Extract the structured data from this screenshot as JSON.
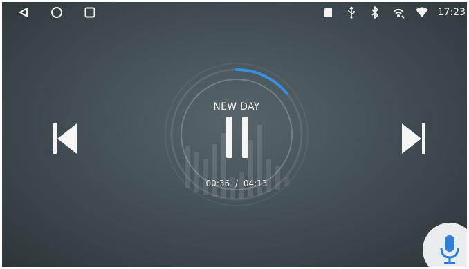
{
  "navbar": {
    "back_icon": "back-triangle-icon",
    "home_icon": "home-circle-icon",
    "recents_icon": "recents-square-icon"
  },
  "status": {
    "icons": [
      "sd-card-icon",
      "usb-icon",
      "bluetooth-icon",
      "wireless-signal-icon",
      "wifi-icon"
    ],
    "time": "17:23"
  },
  "player": {
    "title": "NEW DAY",
    "current_time": "00:36",
    "separator": "/",
    "total_time": "04:13",
    "progress_fraction": 0.142,
    "state_icon": "pause-icon",
    "prev_icon": "skip-previous-icon",
    "next_icon": "skip-next-icon",
    "accent_color": "#3a8fe0"
  },
  "assistant": {
    "icon": "microphone-icon",
    "icon_color": "#2f7fd6"
  }
}
